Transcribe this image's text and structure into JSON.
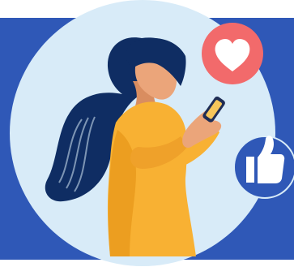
{
  "illustration": {
    "subject": "woman-using-smartphone",
    "icons": [
      "heart-icon",
      "thumbs-up-icon"
    ]
  },
  "colors": {
    "background": "#ffffff",
    "panel_blue": "#2F58B7",
    "circle_light": "#D8EBF8",
    "hair": "#0F2D63",
    "skin": "#EBA57A",
    "skin_shadow": "#D98D60",
    "sweater": "#F8B133",
    "sweater_shadow": "#E99A1C",
    "phone": "#1F2D55",
    "phone_screen": "#F6C65A",
    "heart_badge": "#F26A6B",
    "like_badge": "#2F58B7",
    "icon_white": "#ffffff"
  }
}
